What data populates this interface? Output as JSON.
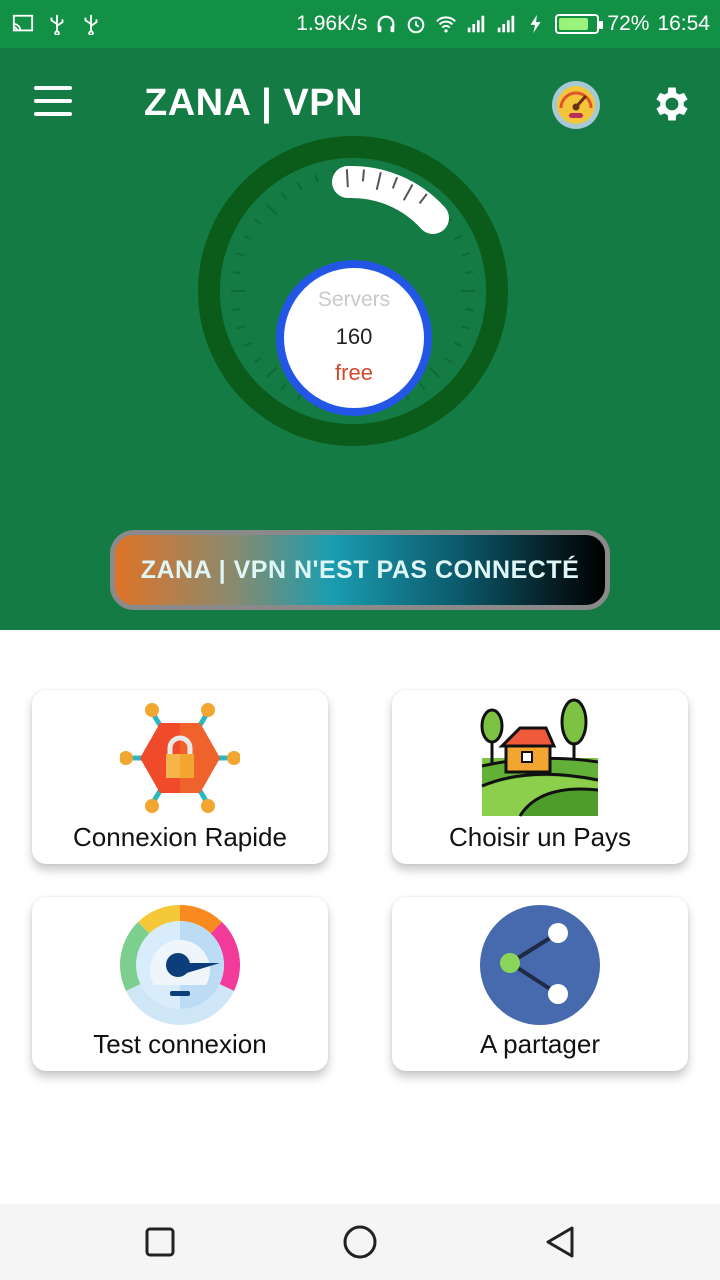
{
  "status_bar": {
    "network_speed": "1.96K/s",
    "battery": "72%",
    "time": "16:54",
    "icons": [
      "cast-icon",
      "usb-icon",
      "usb-icon",
      "headphones-icon",
      "alarm-icon",
      "wifi-icon",
      "signal-icon",
      "signal-icon",
      "charging-icon",
      "battery-icon"
    ]
  },
  "header": {
    "title": "ZANA | VPN",
    "menu_icon": "hamburger-menu-icon",
    "speed_icon": "speedometer-icon",
    "settings_icon": "gear-icon"
  },
  "gauge": {
    "label": "Servers",
    "count": "160",
    "tier": "free"
  },
  "connection": {
    "status_text": "ZANA | VPN N'EST PAS CONNECTÉ"
  },
  "cards": {
    "quick_connect": {
      "label": "Connexion Rapide",
      "icon": "locked-network-icon"
    },
    "choose_country": {
      "label": "Choisir un Pays",
      "icon": "landscape-house-icon"
    },
    "speed_test": {
      "label": "Test connexion",
      "icon": "speed-gauge-icon"
    },
    "share": {
      "label": "A partager",
      "icon": "share-icon"
    }
  },
  "colors": {
    "status_bar": "#129046",
    "header": "#137b43",
    "gauge_ring": "#0b5b1a",
    "inner_ring": "#2356e6",
    "free_text": "#d24a2a"
  },
  "navbar": {
    "buttons": [
      "recent-apps-icon",
      "home-icon",
      "back-icon"
    ]
  }
}
